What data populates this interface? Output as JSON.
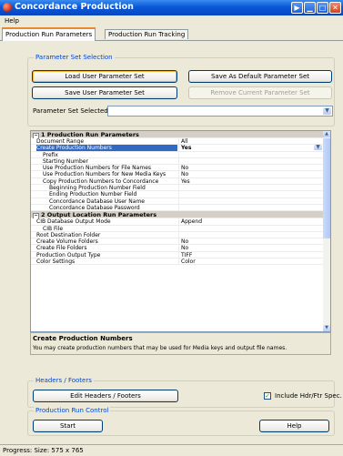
{
  "window": {
    "title": "Concordance Production"
  },
  "menu": {
    "help": "Help"
  },
  "tabs": [
    {
      "label": "Production Run Parameters",
      "active": true
    },
    {
      "label": "Production Run Tracking",
      "active": false
    }
  ],
  "parameter_set": {
    "legend": "Parameter Set Selection",
    "load_label": "Load User Parameter Set",
    "save_default_label": "Save As Default Parameter Set",
    "save_user_label": "Save User Parameter Set",
    "remove_label": "Remove Current Parameter Set",
    "selected_label": "Parameter Set Selected:",
    "selected_value": ""
  },
  "grid": {
    "rows": [
      {
        "type": "category",
        "name": "1 Production Run Parameters"
      },
      {
        "name": "Document Range",
        "value": "All",
        "indent": 0
      },
      {
        "name": "Create Production Numbers",
        "value": "Yes",
        "indent": 0,
        "selected": true
      },
      {
        "name": "Prefix",
        "value": "",
        "indent": 1
      },
      {
        "name": "Starting Number",
        "value": "",
        "indent": 1
      },
      {
        "name": "Use Production Numbers for File Names",
        "value": "No",
        "indent": 1
      },
      {
        "name": "Use Production Numbers for New Media Keys",
        "value": "No",
        "indent": 1
      },
      {
        "name": "Copy Production Numbers to Concordance",
        "value": "Yes",
        "indent": 1
      },
      {
        "name": "Beginning Production Number Field",
        "value": "",
        "indent": 2
      },
      {
        "name": "Ending Production Number Field",
        "value": "",
        "indent": 2
      },
      {
        "name": "Concordance Database User Name",
        "value": "",
        "indent": 2
      },
      {
        "name": "Concordance Database Password",
        "value": "",
        "indent": 2
      },
      {
        "type": "category",
        "name": "2 Output Location Run Parameters"
      },
      {
        "name": "CIB Database Output Mode",
        "value": "Append",
        "indent": 0
      },
      {
        "name": "CIB File",
        "value": "",
        "indent": 1
      },
      {
        "name": "Root Destination Folder",
        "value": "",
        "indent": 0
      },
      {
        "name": "Create Volume Folders",
        "value": "No",
        "indent": 0
      },
      {
        "name": "Create File Folders",
        "value": "No",
        "indent": 0
      },
      {
        "name": "Production Output Type",
        "value": "TIFF",
        "indent": 0
      },
      {
        "name": "Color Settings",
        "value": "Color",
        "indent": 0
      }
    ]
  },
  "description": {
    "title": "Create Production Numbers",
    "text": "You may create production numbers that may be used for Media keys and output file names."
  },
  "headers_footers": {
    "legend": "Headers / Footers",
    "edit_label": "Edit Headers / Footers",
    "include_label": "Include Hdr/Ftr Spec.",
    "include_checked": true
  },
  "run_control": {
    "legend": "Production Run Control",
    "start_label": "Start",
    "help_label": "Help"
  },
  "status": {
    "text": "Progress:  Size: 575 x 765"
  },
  "icons": {
    "app": "production-app-icon",
    "check": "checkmark-icon"
  },
  "colors": {
    "selection": "#316ac5",
    "title_bar": "#0a58d8",
    "legend_text": "#0046d5"
  }
}
